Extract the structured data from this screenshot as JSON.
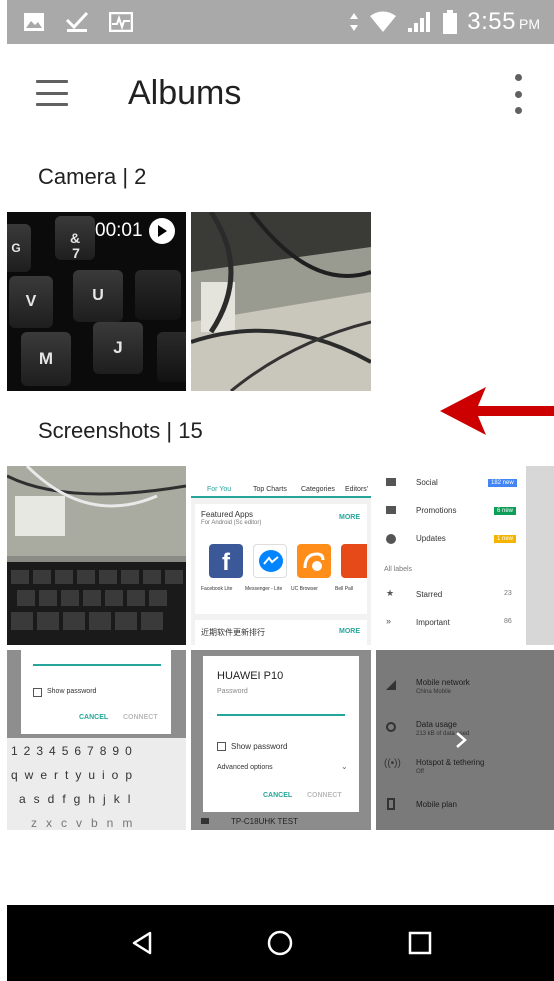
{
  "status_bar": {
    "time": "3:55",
    "ampm": "PM",
    "left_icons": [
      "image-icon",
      "download-done-icon",
      "pulse-icon"
    ],
    "right_icons": [
      "data-arrows-icon",
      "wifi-icon",
      "signal-icon",
      "battery-icon"
    ]
  },
  "header": {
    "title": "Albums",
    "menu_icon": "hamburger-menu-icon",
    "overflow_icon": "more-vert-icon"
  },
  "albums": [
    {
      "title": "Camera | 2",
      "items": [
        {
          "kind": "video",
          "duration": "00:01",
          "keys": [
            "&",
            "7",
            "V",
            "U",
            "M",
            "J",
            "G"
          ]
        },
        {
          "kind": "photo"
        }
      ]
    },
    {
      "title": "Screenshots | 15",
      "items": [
        {
          "kind": "photo"
        },
        {
          "kind": "screenshot-store",
          "tabs": [
            "For You",
            "Top Charts",
            "Categories",
            "Editors'"
          ],
          "card_title": "Featured Apps",
          "card_sub": "For Android (Sc editor)",
          "more": "MORE",
          "apps": [
            "Facebook Lite",
            "Messenger - Lite",
            "UC Browser",
            "Bell Pall"
          ],
          "bottom": "近期软件更新排行"
        },
        {
          "kind": "screenshot-mail",
          "items": [
            "Social",
            "Promotions",
            "Updates"
          ],
          "badges": [
            "182 new",
            "6 new",
            "1 new"
          ],
          "all_labels": "All labels",
          "labels": [
            "Starred",
            "Important"
          ],
          "counts": [
            "23",
            "86"
          ]
        },
        {
          "kind": "screenshot-wifi-dialog",
          "show_password": "Show password",
          "cancel": "CANCEL",
          "connect": "CONNECT",
          "key_rows": [
            "1234567890",
            "qwertyuiop",
            "asdfghjkl",
            "zxcvbnm"
          ]
        },
        {
          "kind": "screenshot-wifi-p10",
          "network": "HUAWEI P10",
          "password_label": "Password",
          "show_password": "Show password",
          "advanced": "Advanced options",
          "cancel": "CANCEL",
          "connect": "CONNECT",
          "footer": "TP-C18UHK TEST"
        },
        {
          "kind": "screenshot-settings",
          "items": [
            {
              "title": "Mobile network",
              "sub": "China Mobile"
            },
            {
              "title": "Data usage",
              "sub": "213 kB of data used"
            },
            {
              "title": "Hotspot & tethering",
              "sub": "Off"
            },
            {
              "title": "Mobile plan",
              "sub": ""
            }
          ]
        }
      ]
    }
  ],
  "annotation": {
    "arrow_color": "#cc0000"
  },
  "nav_bar": {
    "buttons": [
      "back-icon",
      "home-icon",
      "recents-icon"
    ]
  },
  "colors": {
    "status_bar": "#a9a9a9",
    "nav_bar": "#000000",
    "accent": "#26a69a"
  }
}
